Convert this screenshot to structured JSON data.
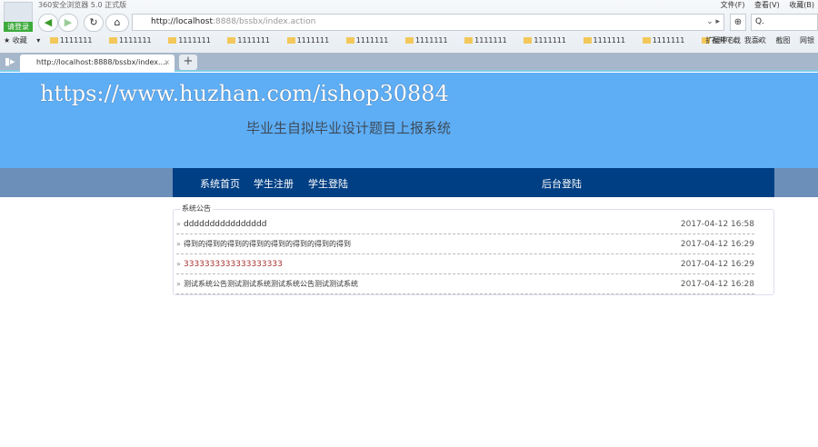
{
  "browser": {
    "window_title": "360安全浏览器 5.0 正式版",
    "login_label": "请登录",
    "menus": [
      "文件(F)",
      "查看(V)",
      "收藏(B)"
    ],
    "address_host": "http://localhost",
    "address_rest": ":8888/bssbx/index.action",
    "search_placeholder": "Q.",
    "bookmarks_label": "收藏",
    "bookmarks": [
      "1111111",
      "1111111",
      "1111111",
      "1111111",
      "1111111",
      "1111111",
      "1111111",
      "1111111",
      "1111111",
      "1111111",
      "1111111",
      "1111111"
    ],
    "bookmark_video": "视频下载",
    "right_tools": [
      "扩展中心",
      "我喜欢",
      "截图",
      "网银"
    ],
    "tab_title": "http://localhost:8888/bssbx/index....",
    "new_tab": "+"
  },
  "banner": {
    "url_text": "https://www.huzhan.com/ishop30884",
    "system_title": "毕业生自拟毕业设计题目上报系统"
  },
  "nav": {
    "home": "系统首页",
    "register": "学生注册",
    "login": "学生登陆",
    "admin": "后台登陆"
  },
  "notices": {
    "legend": "系统公告",
    "items": [
      {
        "title": "dddddddddddddddd",
        "date": "2017-04-12 16:58"
      },
      {
        "title": "得到的得到的得到的得到的得到的得到的得到的得到",
        "date": "2017-04-12 16:29"
      },
      {
        "title": "3333333333333333333",
        "date": "2017-04-12 16:29"
      },
      {
        "title": "测试系统公告测试测试系统测试系统公告测试测试系统",
        "date": "2017-04-12 16:28"
      }
    ]
  },
  "colors": {
    "banner": "#5eaef6",
    "nav": "#003f84"
  }
}
